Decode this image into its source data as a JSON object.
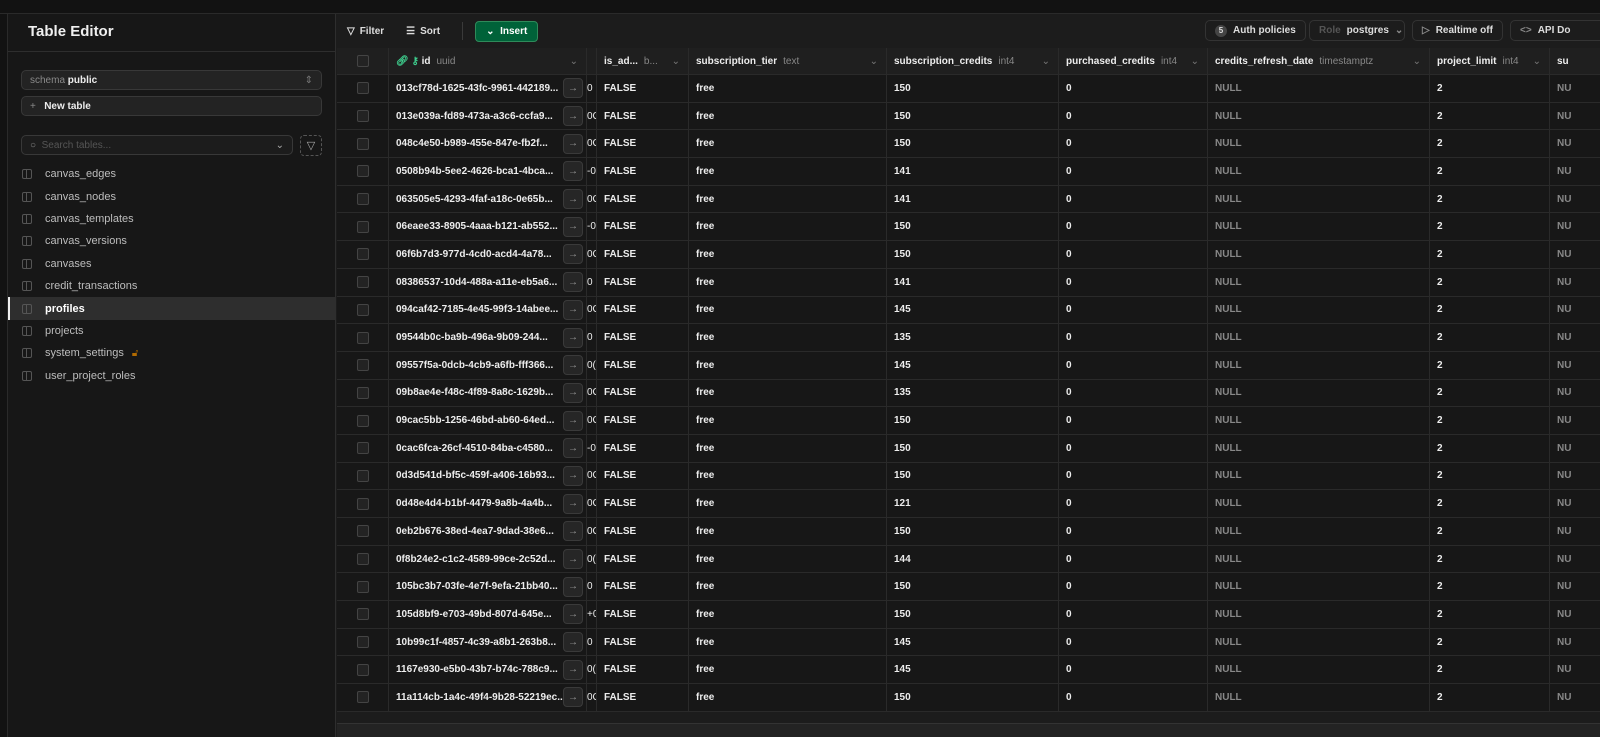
{
  "sidebar": {
    "title": "Table Editor",
    "schema_label": "schema",
    "schema_value": "public",
    "new_table": "New table",
    "search_placeholder": "Search tables...",
    "tables": [
      {
        "name": "canvas_edges"
      },
      {
        "name": "canvas_nodes"
      },
      {
        "name": "canvas_templates"
      },
      {
        "name": "canvas_versions"
      },
      {
        "name": "canvases"
      },
      {
        "name": "credit_transactions"
      },
      {
        "name": "profiles",
        "active": true
      },
      {
        "name": "projects"
      },
      {
        "name": "system_settings",
        "locked": true
      },
      {
        "name": "user_project_roles"
      }
    ]
  },
  "toolbar": {
    "filter": "Filter",
    "sort": "Sort",
    "insert": "Insert",
    "auth_count": "5",
    "auth": "Auth policies",
    "role_label": "Role",
    "role_value": "postgres",
    "realtime": "Realtime off",
    "api_docs": "API Do"
  },
  "accent": "#3ecf8e",
  "columns": [
    {
      "name": "id",
      "type": "uuid"
    },
    {
      "name": "",
      "type": ""
    },
    {
      "name": "is_ad...",
      "type": "b..."
    },
    {
      "name": "subscription_tier",
      "type": "text"
    },
    {
      "name": "subscription_credits",
      "type": "int4"
    },
    {
      "name": "purchased_credits",
      "type": "int4"
    },
    {
      "name": "credits_refresh_date",
      "type": "timestamptz"
    },
    {
      "name": "project_limit",
      "type": "int4"
    },
    {
      "name": "su",
      "type": ""
    }
  ],
  "rows": [
    {
      "id": "013cf78d-1625-43fc-9961-442189...",
      "p": "0",
      "credits": "150"
    },
    {
      "id": "013e039a-fd89-473a-a3c6-ccfa9...",
      "p": "0C",
      "credits": "150"
    },
    {
      "id": "048c4e50-b989-455e-847e-fb2f...",
      "p": "0C",
      "credits": "150"
    },
    {
      "id": "0508b94b-5ee2-4626-bca1-4bca...",
      "p": "-0",
      "credits": "141"
    },
    {
      "id": "063505e5-4293-4faf-a18c-0e65b...",
      "p": "0C",
      "credits": "141"
    },
    {
      "id": "06eaee33-8905-4aaa-b121-ab552...",
      "p": "-0",
      "credits": "150"
    },
    {
      "id": "06f6b7d3-977d-4cd0-acd4-4a78...",
      "p": "0C",
      "credits": "150"
    },
    {
      "id": "08386537-10d4-488a-a11e-eb5a6...",
      "p": "0",
      "credits": "141"
    },
    {
      "id": "094caf42-7185-4e45-99f3-14abee...",
      "p": "0C",
      "credits": "145"
    },
    {
      "id": "09544b0c-ba9b-496a-9b09-244...",
      "p": "0",
      "credits": "135"
    },
    {
      "id": "09557f5a-0dcb-4cb9-a6fb-fff366...",
      "p": "0(",
      "credits": "145"
    },
    {
      "id": "09b8ae4e-f48c-4f89-8a8c-1629b...",
      "p": "0C",
      "credits": "135"
    },
    {
      "id": "09cac5bb-1256-46bd-ab60-64ed...",
      "p": "0C",
      "credits": "150"
    },
    {
      "id": "0cac6fca-26cf-4510-84ba-c4580...",
      "p": "-0",
      "credits": "150"
    },
    {
      "id": "0d3d541d-bf5c-459f-a406-16b93...",
      "p": "0C",
      "credits": "150"
    },
    {
      "id": "0d48e4d4-b1bf-4479-9a8b-4a4b...",
      "p": "0C",
      "credits": "121"
    },
    {
      "id": "0eb2b676-38ed-4ea7-9dad-38e6...",
      "p": "0C",
      "credits": "150"
    },
    {
      "id": "0f8b24e2-c1c2-4589-99ce-2c52d...",
      "p": "0(",
      "credits": "144"
    },
    {
      "id": "105bc3b7-03fe-4e7f-9efa-21bb40...",
      "p": "0",
      "credits": "150"
    },
    {
      "id": "105d8bf9-e703-49bd-807d-645e...",
      "p": "+0",
      "credits": "150"
    },
    {
      "id": "10b99c1f-4857-4c39-a8b1-263b8...",
      "p": "0",
      "credits": "145"
    },
    {
      "id": "1167e930-e5b0-43b7-b74c-788c9...",
      "p": "0(",
      "credits": "145"
    },
    {
      "id": "11a114cb-1a4c-49f4-9b28-52219ec...",
      "p": "0C",
      "credits": "150"
    }
  ],
  "cell_defaults": {
    "is_admin": "FALSE",
    "tier": "free",
    "purchased": "0",
    "refresh": "NULL",
    "limit": "2",
    "su": "NU"
  }
}
